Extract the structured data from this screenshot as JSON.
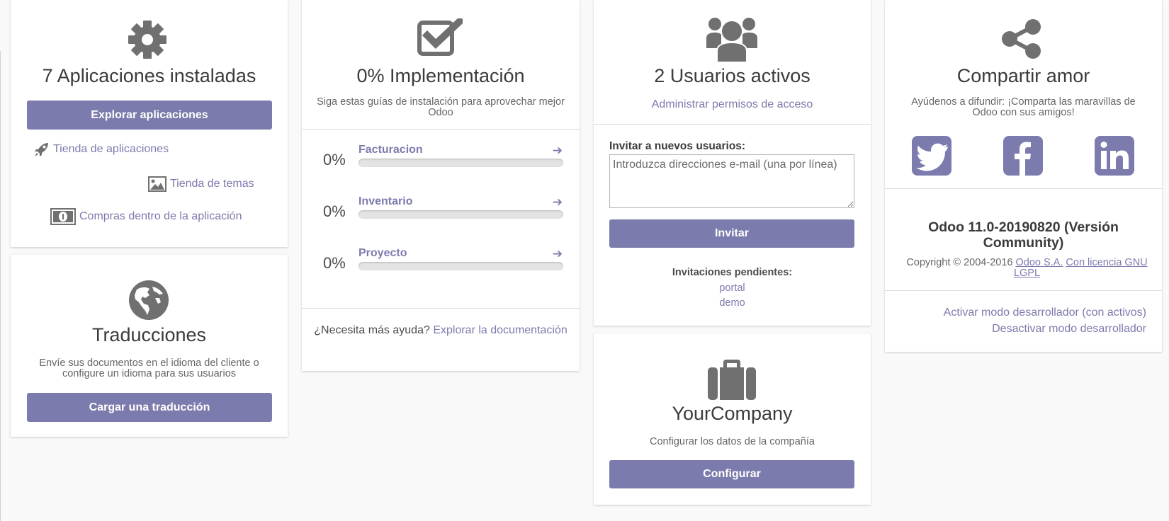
{
  "apps": {
    "title": "7 Aplicaciones instaladas",
    "explore_button": "Explorar aplicaciones",
    "links": {
      "app_store": "Tienda de aplicaciones",
      "theme_store": "Tienda de temas",
      "in_app_purchases": "Compras dentro de la aplicación"
    }
  },
  "translations": {
    "title": "Traducciones",
    "description": "Envíe sus documentos en el idioma del cliente o configure un idioma para sus usuarios",
    "load_button": "Cargar una traducción"
  },
  "implementation": {
    "title": "0% Implementación",
    "subtitle": "Siga estas guías de instalación para aprovechar mejor Odoo",
    "items": [
      {
        "percent_label": "0%",
        "name": "Facturacion",
        "progress": 0
      },
      {
        "percent_label": "0%",
        "name": "Inventario",
        "progress": 0
      },
      {
        "percent_label": "0%",
        "name": "Proyecto",
        "progress": 0
      }
    ],
    "help_text": "¿Necesita más ayuda?",
    "help_link": "Explorar la documentación"
  },
  "users": {
    "title": "2 Usuarios activos",
    "manage_link": "Administrar permisos de acceso",
    "invite_label": "Invitar a nuevos usuarios:",
    "invite_placeholder": "Introduzca direcciones e-mail (una por línea)",
    "invite_button": "Invitar",
    "pending_label": "Invitaciones pendientes:",
    "pending": [
      "portal",
      "demo"
    ]
  },
  "company": {
    "title": "YourCompany",
    "description": "Configurar los datos de la compañía",
    "configure_button": "Configurar"
  },
  "share": {
    "title": "Compartir amor",
    "description": "Ayúdenos a difundir: ¡Comparta las maravillas de Odoo con sus amigos!",
    "networks": [
      "twitter-icon",
      "facebook-icon",
      "linkedin-icon"
    ]
  },
  "about": {
    "version": "Odoo 11.0-20190820 (Versión Community)",
    "copyright": "Copyright © 2004-2016",
    "company_link": "Odoo S.A.",
    "license_link": "Con licencia GNU LGPL",
    "dev_mode_assets": "Activar modo desarrollador (con activos)",
    "dev_mode_off": "Desactivar modo desarrollador"
  },
  "colors": {
    "accent": "#7c7bad",
    "icon_gray": "#707070",
    "background": "#f9f9f9"
  }
}
